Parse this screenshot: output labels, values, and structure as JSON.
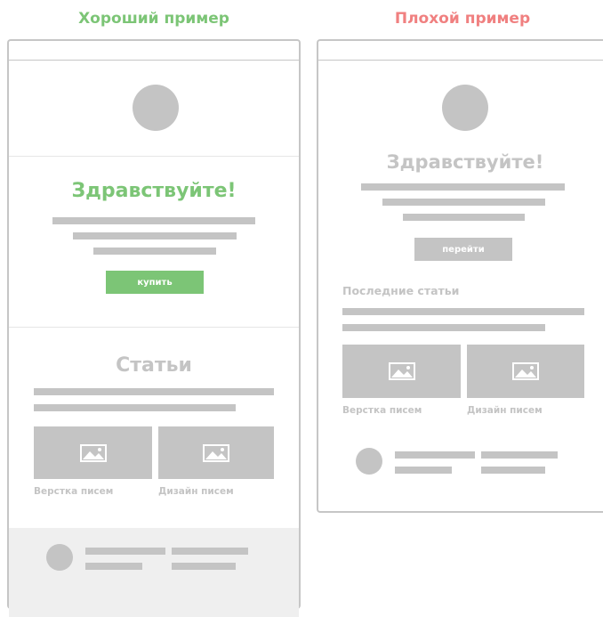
{
  "good": {
    "heading": "Хороший пример",
    "greeting": "Здравствуйте!",
    "button": "купить",
    "section_title": "Статьи",
    "caption_1": "Верстка писем",
    "caption_2": "Дизайн писем"
  },
  "bad": {
    "heading": "Плохой пример",
    "greeting": "Здравствуйте!",
    "button": "перейти",
    "section_title": "Последние статьи",
    "caption_1": "Верстка писем",
    "caption_2": "Дизайн писем"
  },
  "colors": {
    "good_accent": "#7cc576",
    "bad_accent": "#f08080",
    "placeholder": "#c4c4c4",
    "footer_bg": "#efefef"
  },
  "icons": {
    "image_placeholder": "image-icon"
  }
}
